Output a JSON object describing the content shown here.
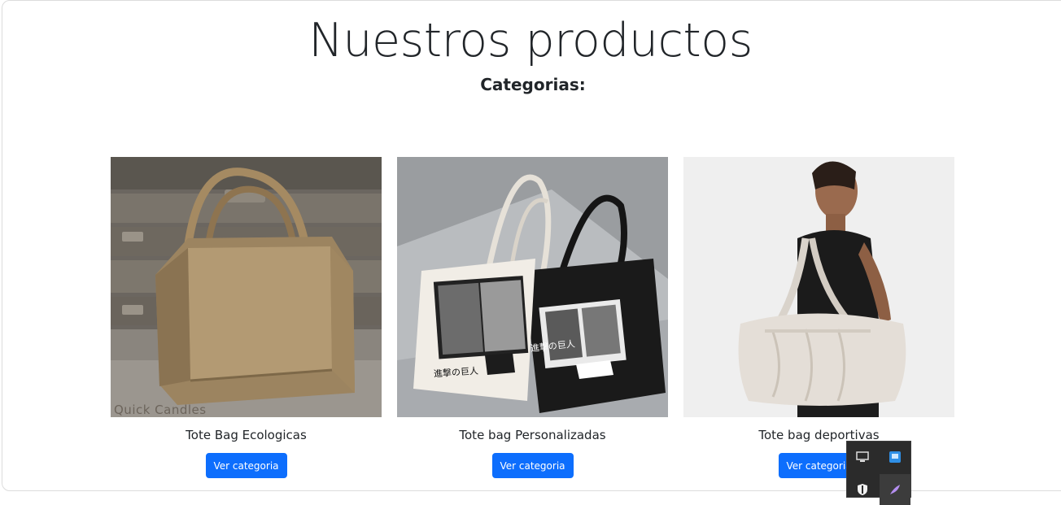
{
  "page": {
    "title": "Nuestros productos",
    "subtitle": "Categorias:"
  },
  "products": [
    {
      "title": "Tote Bag Ecologicas",
      "button": "Ver categoria",
      "image_watermark": "Quick Candles"
    },
    {
      "title": "Tote bag Personalizadas",
      "button": "Ver categoria",
      "image_text": "進撃の巨人"
    },
    {
      "title": "Tote bag deportivas",
      "button": "Ver categoria"
    }
  ],
  "colors": {
    "primary": "#0d6efd",
    "text": "#212529",
    "tray_bg": "#2b2b2b"
  },
  "tray_icons": [
    "display-icon",
    "network-icon",
    "security-shield-icon",
    "feather-pen-icon"
  ]
}
